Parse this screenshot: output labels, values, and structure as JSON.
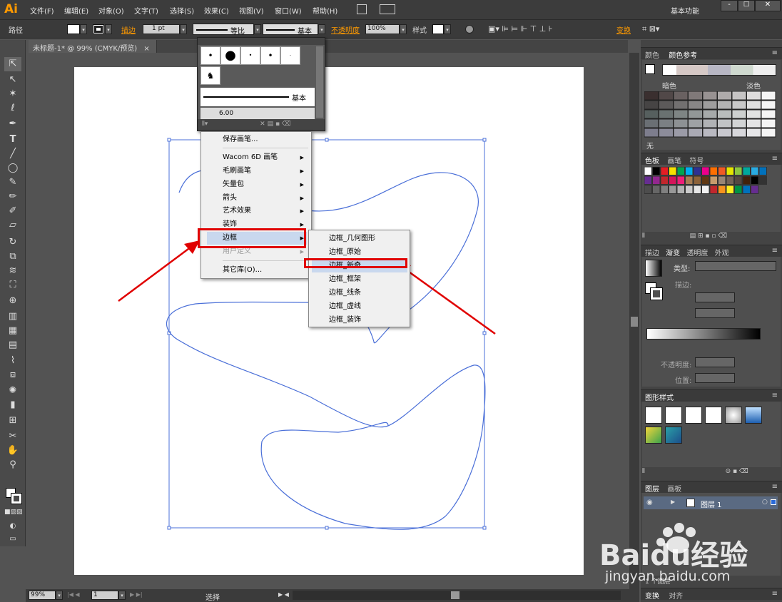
{
  "app": {
    "logo": "Ai",
    "workspace": "基本功能"
  },
  "menubar": {
    "items": [
      "文件(F)",
      "编辑(E)",
      "对象(O)",
      "文字(T)",
      "选择(S)",
      "效果(C)",
      "视图(V)",
      "窗口(W)",
      "帮助(H)"
    ],
    "window_controls": [
      "-",
      "□",
      "✕"
    ]
  },
  "control_bar": {
    "object_type": "路径",
    "stroke_label": "描边",
    "stroke_weight": "1 pt",
    "profile_label": "等比",
    "brush_label": "基本",
    "opacity_label": "不透明度",
    "opacity_value": "100%",
    "style_label": "样式",
    "recolor_label": "变换"
  },
  "document": {
    "tab_title": "未标题-1* @ 99% (CMYK/预览)",
    "tab_close": "×"
  },
  "brush_panel": {
    "basic_label": "基本",
    "size_label": "6.00",
    "menu_items": [
      {
        "label": "保存画笔...",
        "submenu": false
      },
      {
        "label": "Wacom 6D 画笔",
        "submenu": true
      },
      {
        "label": "毛刷画笔",
        "submenu": true
      },
      {
        "label": "矢量包",
        "submenu": true
      },
      {
        "label": "箭头",
        "submenu": true
      },
      {
        "label": "艺术效果",
        "submenu": true
      },
      {
        "label": "装饰",
        "submenu": true
      },
      {
        "label": "边框",
        "submenu": true,
        "highlighted": true
      },
      {
        "label": "用户定义",
        "submenu": true,
        "disabled": true
      },
      {
        "label": "其它库(O)...",
        "submenu": false
      }
    ],
    "border_submenu": [
      "边框_几何图形",
      "边框_原始",
      "边框_新奇",
      "边框_框架",
      "边框_线条",
      "边框_虚线",
      "边框_装饰"
    ]
  },
  "status_bar": {
    "zoom": "99%",
    "page": "1",
    "mode": "选择"
  },
  "panels": {
    "color_tabs": [
      "颜色",
      "颜色参考"
    ],
    "color_guide_left": "暗色",
    "color_guide_right": "淡色",
    "color_guide_footer": "无",
    "swatch_tabs": [
      "色板",
      "画笔",
      "符号"
    ],
    "gradient_tabs": [
      "描边",
      "渐变",
      "透明度",
      "外观"
    ],
    "gradient_type_label": "类型:",
    "gradient_stroke_label": "描边:",
    "gradient_opacity_label": "不透明度:",
    "gradient_position_label": "位置:",
    "graphic_styles_title": "图形样式",
    "layers_tabs": [
      "图层",
      "画板"
    ],
    "layer_name": "图层 1",
    "layer_count": "1 个图层",
    "bottom_tabs": [
      "变换",
      "对齐"
    ]
  },
  "watermark": {
    "brand": "Baidu经验",
    "url": "jingyan.baidu.com"
  },
  "colors": {
    "highlight_red": "#e00000",
    "path_blue": "#4a6fd8",
    "ui_dark": "#535353",
    "logo_orange": "#ff9a00"
  }
}
